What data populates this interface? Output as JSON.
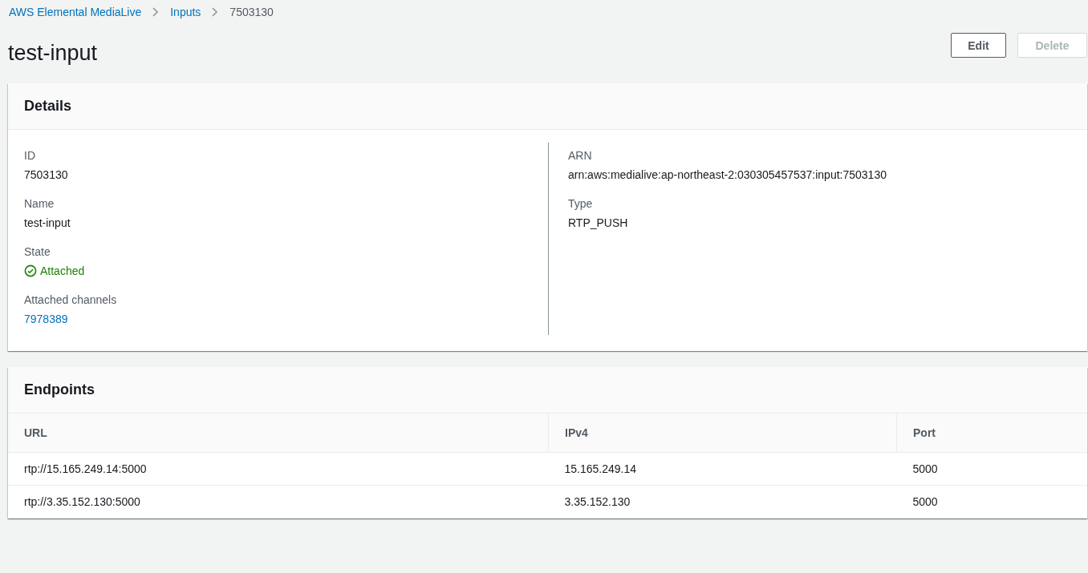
{
  "breadcrumbs": [
    {
      "label": "AWS Elemental MediaLive",
      "kind": "link"
    },
    {
      "label": "Inputs",
      "kind": "link"
    },
    {
      "label": "7503130",
      "kind": "current"
    }
  ],
  "title": "test-input",
  "buttons": [
    {
      "label": "Edit",
      "disabled": false
    },
    {
      "label": "Delete",
      "disabled": true
    }
  ],
  "details": {
    "title": "Details",
    "columns": [
      [
        {
          "label": "ID",
          "value": "7503130",
          "kind": "text"
        },
        {
          "label": "Name",
          "value": "test-input",
          "kind": "text"
        },
        {
          "label": "State",
          "value": "Attached",
          "kind": "status"
        },
        {
          "label": "Attached channels",
          "value": "7978389",
          "kind": "link"
        }
      ],
      [
        {
          "label": "ARN",
          "value": "arn:aws:medialive:ap-northeast-2:030305457537:input:7503130",
          "kind": "text"
        },
        {
          "label": "Type",
          "value": "RTP_PUSH",
          "kind": "text"
        }
      ]
    ]
  },
  "endpoints": {
    "title": "Endpoints",
    "columns": [
      "URL",
      "IPv4",
      "Port"
    ],
    "rows": [
      [
        "rtp://15.165.249.14:5000",
        "15.165.249.14",
        "5000"
      ],
      [
        "rtp://3.35.152.130:5000",
        "3.35.152.130",
        "5000"
      ]
    ]
  }
}
